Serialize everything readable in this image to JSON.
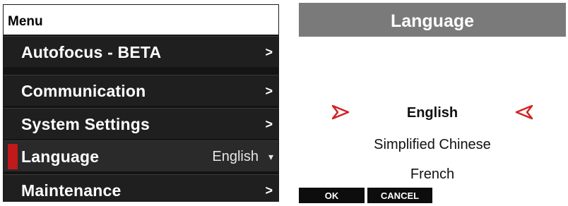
{
  "menu": {
    "title": "Menu",
    "items": [
      {
        "label": "Autofocus - BETA",
        "chevron": ">"
      },
      {
        "label": "Communication",
        "chevron": ">"
      },
      {
        "label": "System Settings",
        "chevron": ">"
      },
      {
        "label": "Language",
        "value": "English",
        "dropdown": "▾"
      },
      {
        "label": "Maintenance",
        "chevron": ">"
      }
    ]
  },
  "language_picker": {
    "title": "Language",
    "options": [
      "English",
      "Simplified Chinese",
      "French"
    ],
    "selected_index": 0,
    "softkeys": {
      "ok": "OK",
      "cancel": "CANCEL"
    }
  },
  "colors": {
    "menu_bg": "#1f1f1f",
    "selection_accent": "#c21a1a",
    "title_bar": "#7a7a7a"
  },
  "icons": {
    "chevron": "chevron-right-icon",
    "dropdown": "chevron-down-icon",
    "selection_markers": "red-outline-arrow-icon"
  }
}
